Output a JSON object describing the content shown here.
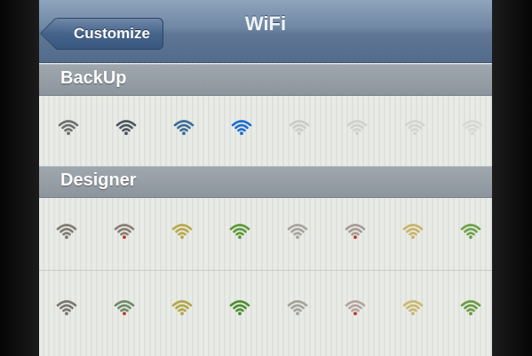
{
  "nav": {
    "title": "WiFi",
    "back_label": "Customize"
  },
  "sections": [
    {
      "label": "BackUp",
      "rows": [
        {
          "icons": [
            {
              "name": "wifi-icon-backup-1",
              "color": "#6f6f6f",
              "dot": "#6f6f6f"
            },
            {
              "name": "wifi-icon-backup-2",
              "color": "#4c5660",
              "dot": "#4c5660"
            },
            {
              "name": "wifi-icon-backup-3",
              "color": "#3d6d97",
              "dot": "#3d6d97"
            },
            {
              "name": "wifi-icon-backup-4",
              "color": "#1f6fd0",
              "dot": "#1f6fd0"
            },
            {
              "name": "wifi-icon-backup-5",
              "color": "#c9ccc8",
              "dot": "#c9ccc8"
            },
            {
              "name": "wifi-icon-backup-6",
              "color": "#cfd1cd",
              "dot": "#cfd1cd"
            },
            {
              "name": "wifi-icon-backup-7",
              "color": "#d3d5d1",
              "dot": "#d3d5d1"
            },
            {
              "name": "wifi-icon-backup-8",
              "color": "#d6d8d4",
              "dot": "#d6d8d4"
            }
          ]
        }
      ]
    },
    {
      "label": "Designer",
      "rows": [
        {
          "icons": [
            {
              "name": "wifi-icon-designer-1",
              "color": "#7f7a72",
              "dot": "#7f7a72"
            },
            {
              "name": "wifi-icon-designer-2",
              "color": "#8a7f76",
              "dot": "#c0392b"
            },
            {
              "name": "wifi-icon-designer-3",
              "color": "#b9a94a",
              "dot": "#b9a94a"
            },
            {
              "name": "wifi-icon-designer-4",
              "color": "#5d9a3b",
              "dot": "#5d9a3b"
            },
            {
              "name": "wifi-icon-designer-5",
              "color": "#a7a49c",
              "dot": "#a7a49c"
            },
            {
              "name": "wifi-icon-designer-6",
              "color": "#a89a94",
              "dot": "#c0392b"
            },
            {
              "name": "wifi-icon-designer-7",
              "color": "#c8b46a",
              "dot": "#c8b46a"
            },
            {
              "name": "wifi-icon-designer-8",
              "color": "#6ea24a",
              "dot": "#6ea24a"
            }
          ]
        },
        {
          "icons": [
            {
              "name": "wifi-icon-designer-9",
              "color": "#7a7670",
              "dot": "#7a7670"
            },
            {
              "name": "wifi-icon-designer-10",
              "color": "#6f8a6a",
              "dot": "#c0392b"
            },
            {
              "name": "wifi-icon-designer-11",
              "color": "#b3a648",
              "dot": "#b3a648"
            },
            {
              "name": "wifi-icon-designer-12",
              "color": "#4f8f34",
              "dot": "#4f8f34"
            },
            {
              "name": "wifi-icon-designer-13",
              "color": "#a4a29b",
              "dot": "#a4a29b"
            },
            {
              "name": "wifi-icon-designer-14",
              "color": "#b5a3a0",
              "dot": "#c0392b"
            },
            {
              "name": "wifi-icon-designer-15",
              "color": "#c9b96c",
              "dot": "#c9b96c"
            },
            {
              "name": "wifi-icon-designer-16",
              "color": "#6a9c44",
              "dot": "#6a9c44"
            }
          ]
        }
      ]
    }
  ]
}
